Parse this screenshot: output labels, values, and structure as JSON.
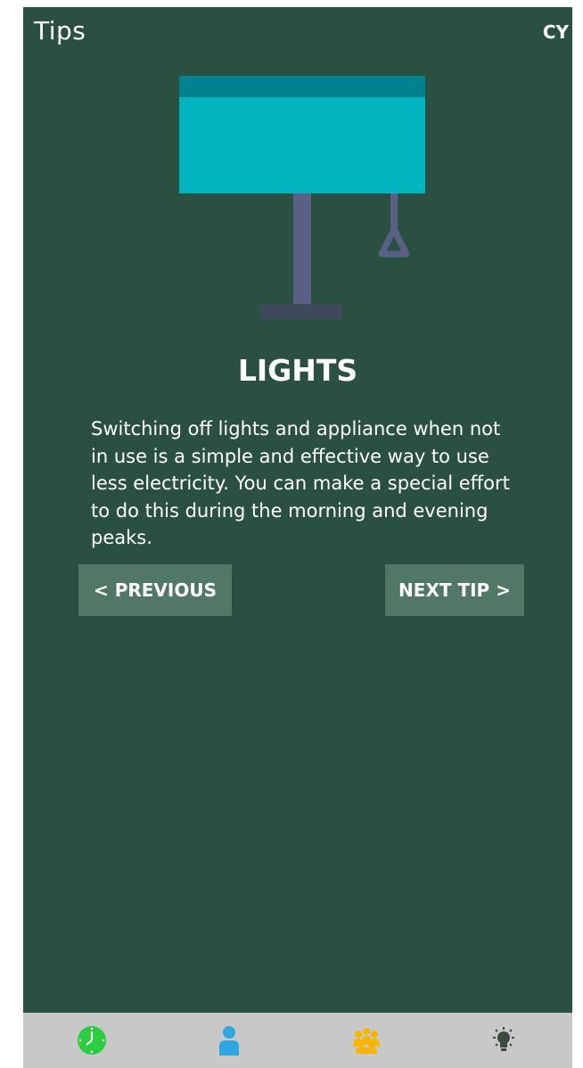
{
  "header": {
    "title": "Tips",
    "language": "CY"
  },
  "tip": {
    "title": "LIGHTS",
    "body": "Switching off lights and appliance when not in use is a simple and effective way to use less electricity. You can make a special effort to do this during the morning and evening peaks."
  },
  "buttons": {
    "previous": "< PREVIOUS",
    "next": "NEXT TIP >"
  },
  "illustration": {
    "name": "lamp-illustration",
    "colors": {
      "shade": "#00b4bf",
      "shade_top": "#00838e",
      "pole": "#5a5f85",
      "base": "#3e4a5c"
    }
  },
  "tabbar": {
    "tabs": [
      {
        "icon": "clock-icon",
        "color": "#2ecc40"
      },
      {
        "icon": "person-icon",
        "color": "#2ea6e0"
      },
      {
        "icon": "group-icon",
        "color": "#f7b500"
      },
      {
        "icon": "lightbulb-icon",
        "color": "#3a4a3f",
        "active": true
      }
    ]
  },
  "colors": {
    "background": "#2a5041",
    "button": "#517867",
    "tabbar": "#c8c8c8"
  }
}
